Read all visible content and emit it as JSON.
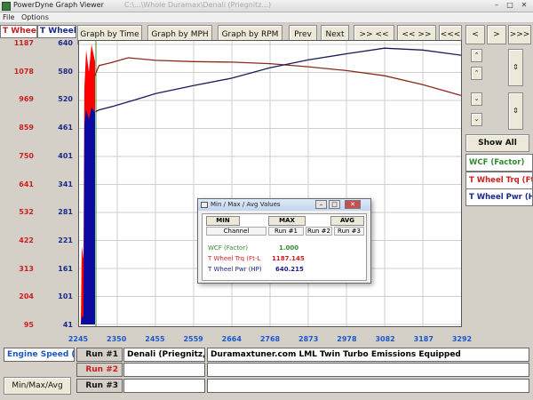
{
  "window": {
    "title": "PowerDyne Graph Viewer",
    "title_faint": "C:\\...\\Whole Duramax\\Denali (Priegnitz...)",
    "ctrl_min": "–",
    "ctrl_max": "□",
    "ctrl_close": "✕"
  },
  "menu": {
    "file": "File",
    "options": "Options"
  },
  "left_headers": {
    "trq": "T Wheel Trq",
    "pwr": "T Wheel Pwr"
  },
  "y_left_trq": [
    "1187",
    "1078",
    "969",
    "859",
    "750",
    "641",
    "532",
    "422",
    "313",
    "204",
    "95"
  ],
  "y_left_pwr": [
    "640",
    "580",
    "520",
    "461",
    "401",
    "341",
    "281",
    "221",
    "161",
    "101",
    "41"
  ],
  "toolbar": {
    "graph_time": "Graph by Time",
    "graph_mph": "Graph by MPH",
    "graph_rpm": "Graph by RPM",
    "prev": "Prev",
    "next": "Next",
    "zoom_in": ">> <<",
    "zoom_out": "<< >>",
    "far_left": "<<<",
    "left": "<",
    "right": ">",
    "far_right": ">>>"
  },
  "right_panel": {
    "show_all": "Show All",
    "legend_wcf": "WCF (Factor)",
    "legend_trq": "T Wheel Trq (Ft-L",
    "legend_pwr": "T Wheel Pwr (HP"
  },
  "chart_data": {
    "type": "line",
    "x_ticks": [
      "2245",
      "2350",
      "2455",
      "2559",
      "2664",
      "2768",
      "2873",
      "2978",
      "3082",
      "3187",
      "3292"
    ],
    "xlim": [
      2245,
      3292
    ],
    "y_trq_ticks": [
      1187,
      1078,
      969,
      859,
      750,
      641,
      532,
      422,
      313,
      204,
      95
    ],
    "y_pwr_ticks": [
      640,
      580,
      520,
      461,
      401,
      341,
      281,
      221,
      161,
      101,
      41
    ],
    "ylim_trq": [
      95,
      1187
    ],
    "ylim_pwr": [
      41,
      640
    ],
    "grid": true,
    "series": [
      {
        "name": "T Wheel Trq (Ft-L",
        "axis": "trq",
        "color": "#8b2a1a",
        "x": [
          2285,
          2300,
          2330,
          2380,
          2455,
          2559,
          2664,
          2768,
          2873,
          2978,
          3082,
          3187,
          3292
        ],
        "y": [
          1055,
          1105,
          1115,
          1135,
          1125,
          1120,
          1118,
          1112,
          1100,
          1085,
          1065,
          1030,
          988
        ]
      },
      {
        "name": "T Wheel Pwr (HP",
        "axis": "pwr",
        "color": "#1a1a5a",
        "x": [
          2290,
          2300,
          2340,
          2400,
          2455,
          2559,
          2664,
          2768,
          2873,
          2978,
          3082,
          3187,
          3292
        ],
        "y": [
          496,
          500,
          508,
          522,
          535,
          552,
          568,
          590,
          607,
          620,
          632,
          628,
          617
        ]
      }
    ],
    "fill_burst": {
      "trq_color": "#ff0000",
      "pwr_color": "#0a0aa0"
    }
  },
  "dialog": {
    "title": "Min / Max / Avg Values",
    "min": "MIN",
    "max": "MAX",
    "avg": "AVG",
    "col_channel": "Channel",
    "col_run1": "Run #1",
    "col_run2": "Run #2",
    "col_run3": "Run #3",
    "rows": [
      {
        "name": "WCF (Factor)",
        "run1": "1.000",
        "color": "#2e8b2e"
      },
      {
        "name": "T Wheel Trq (Ft-L",
        "run1": "1187.145",
        "color": "#cc2020"
      },
      {
        "name": "T Wheel Pwr (HP)",
        "run1": "640.215",
        "color": "#1a1a8a"
      }
    ]
  },
  "bottom": {
    "channel": "Engine Speed (RI",
    "run1_label": "Run #1",
    "run2_label": "Run #2",
    "run3_label": "Run #3",
    "vehicle": "Denali (Priegnitz, nic",
    "description": "Duramaxtuner.com LML Twin Turbo Emissions Equipped",
    "minmax_button": "Min/Max/Avg"
  },
  "colors": {
    "trq_axis": "#cc1e1e",
    "pwr_axis": "#1a2a8a",
    "x_axis": "#1b58c9",
    "grid": "#cfcfcf"
  }
}
